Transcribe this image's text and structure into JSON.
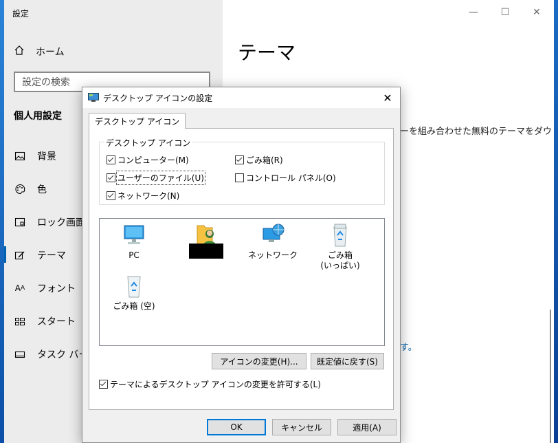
{
  "settings": {
    "app_title": "設定",
    "home_label": "ホーム",
    "search_placeholder": "設定の検索",
    "section_heading": "個人用設定",
    "nav": [
      {
        "label": "背景",
        "icon": "picture-icon"
      },
      {
        "label": "色",
        "icon": "palette-icon"
      },
      {
        "label": "ロック画面",
        "icon": "lock-screen-icon"
      },
      {
        "label": "テーマ",
        "icon": "theme-brush-icon"
      },
      {
        "label": "フォント",
        "icon": "font-icon"
      },
      {
        "label": "スタート",
        "icon": "start-icon"
      },
      {
        "label": "タスク バー",
        "icon": "taskbar-icon"
      }
    ],
    "page_title": "テーマ",
    "desc_fragment": "ーを組み合わせた無料のテーマをダウ",
    "link_fragment": "ます。"
  },
  "dialog": {
    "title": "デスクトップ アイコンの設定",
    "close": "✕",
    "tab_label": "デスクトップ アイコン",
    "group_label": "デスクトップ アイコン",
    "checkboxes": [
      {
        "label": "コンピューター(M)",
        "checked": true
      },
      {
        "label": "ごみ箱(R)",
        "checked": true
      },
      {
        "label": "ユーザーのファイル(U)",
        "checked": true
      },
      {
        "label": "コントロール パネル(O)",
        "checked": false
      },
      {
        "label": "ネットワーク(N)",
        "checked": true
      }
    ],
    "icons": [
      {
        "label": "PC",
        "icon": "pc-monitor-icon"
      },
      {
        "label": "",
        "icon": "user-folder-icon"
      },
      {
        "label": "ネットワーク",
        "icon": "network-icon"
      },
      {
        "label": "ごみ箱\n(いっぱい)",
        "icon": "recycle-bin-full-icon"
      },
      {
        "label": "ごみ箱 (空)",
        "icon": "recycle-bin-empty-icon"
      }
    ],
    "change_icon_button": "アイコンの変更(H)...",
    "restore_default_button": "既定値に戻す(S)",
    "allow_theme_checkbox": {
      "label": "テーマによるデスクトップ アイコンの変更を許可する(L)",
      "checked": true
    },
    "ok_button": "OK",
    "cancel_button": "キャンセル",
    "apply_button": "適用(A)"
  },
  "colors": {
    "accent": "#0078d7",
    "link": "#0063b1"
  }
}
